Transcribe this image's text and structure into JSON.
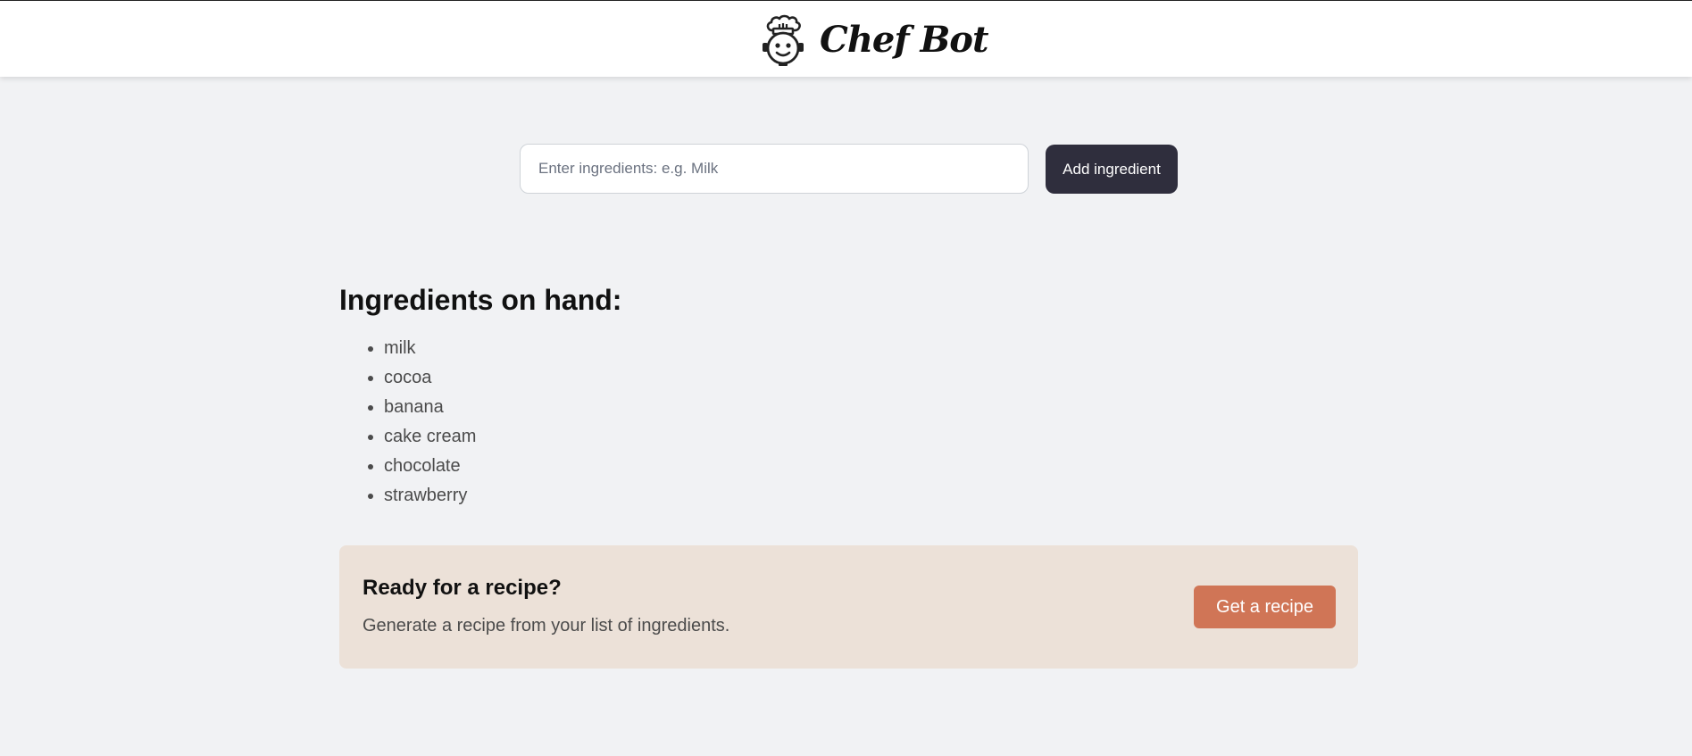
{
  "header": {
    "title": "Chef Bot",
    "logo_icon": "chef-robot-icon"
  },
  "search": {
    "placeholder": "Enter ingredients: e.g. Milk",
    "value": "",
    "add_button_label": "Add ingredient"
  },
  "ingredients": {
    "heading": "Ingredients on hand:",
    "items": [
      "milk",
      "cocoa",
      "banana",
      "cake cream",
      "chocolate",
      "strawberry"
    ]
  },
  "recipe_card": {
    "title": "Ready for a recipe?",
    "description": "Generate a recipe from your list of ingredients.",
    "button_label": "Get a recipe",
    "background_color": "#ece1d8",
    "button_color": "#d07556"
  },
  "colors": {
    "page_background": "#f1f2f4",
    "header_background": "#ffffff",
    "primary_button": "#2f2e3d"
  }
}
